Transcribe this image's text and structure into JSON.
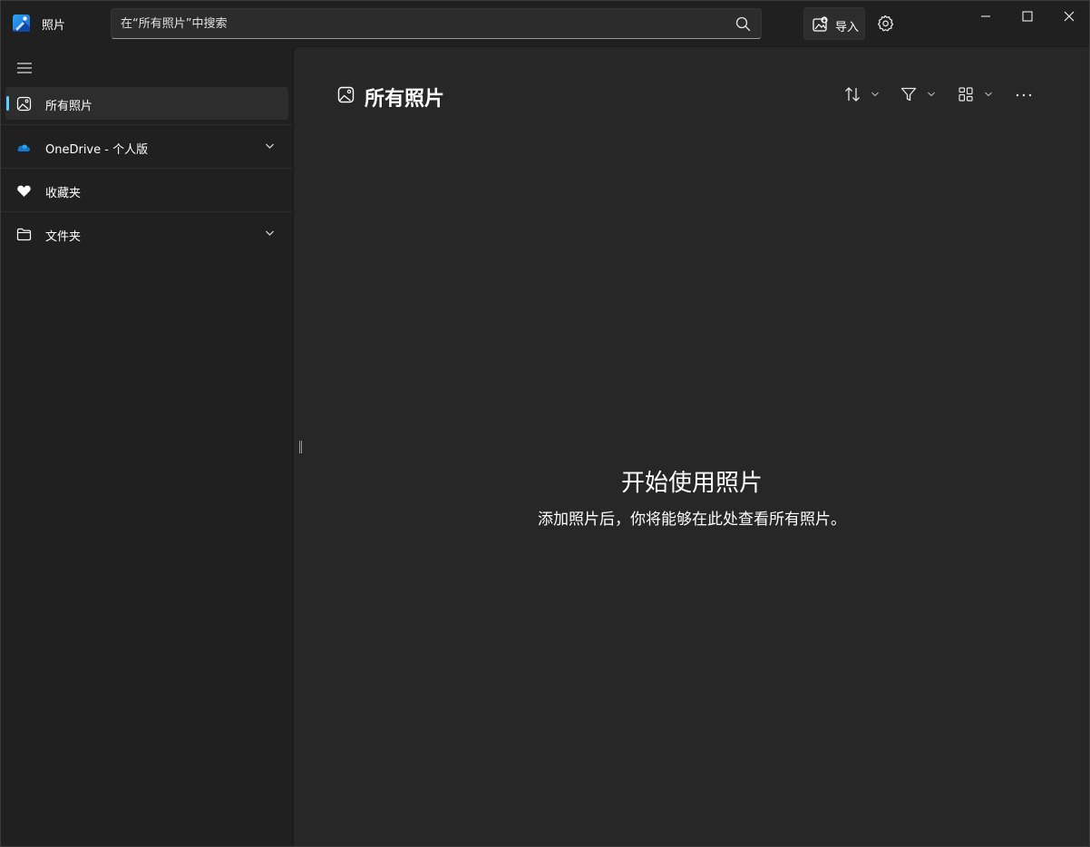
{
  "app": {
    "title": "照片"
  },
  "search": {
    "placeholder": "在“所有照片”中搜索"
  },
  "toolbar": {
    "import_label": "导入"
  },
  "sidebar": {
    "items": [
      {
        "label": "所有照片",
        "icon": "photo-icon",
        "active": true
      },
      {
        "label": "OneDrive - 个人版",
        "icon": "onedrive-cloud-icon",
        "expandable": true
      },
      {
        "label": "收藏夹",
        "icon": "heart-icon"
      },
      {
        "label": "文件夹",
        "icon": "folder-icon",
        "expandable": true
      }
    ]
  },
  "main": {
    "title": "所有照片",
    "empty_state": {
      "title": "开始使用照片",
      "subtitle": "添加照片后，你将能够在此处查看所有照片。"
    }
  },
  "colors": {
    "accent": "#60cdff",
    "onedrive": "#0f78d4",
    "background": "#202020",
    "content": "#272727"
  }
}
